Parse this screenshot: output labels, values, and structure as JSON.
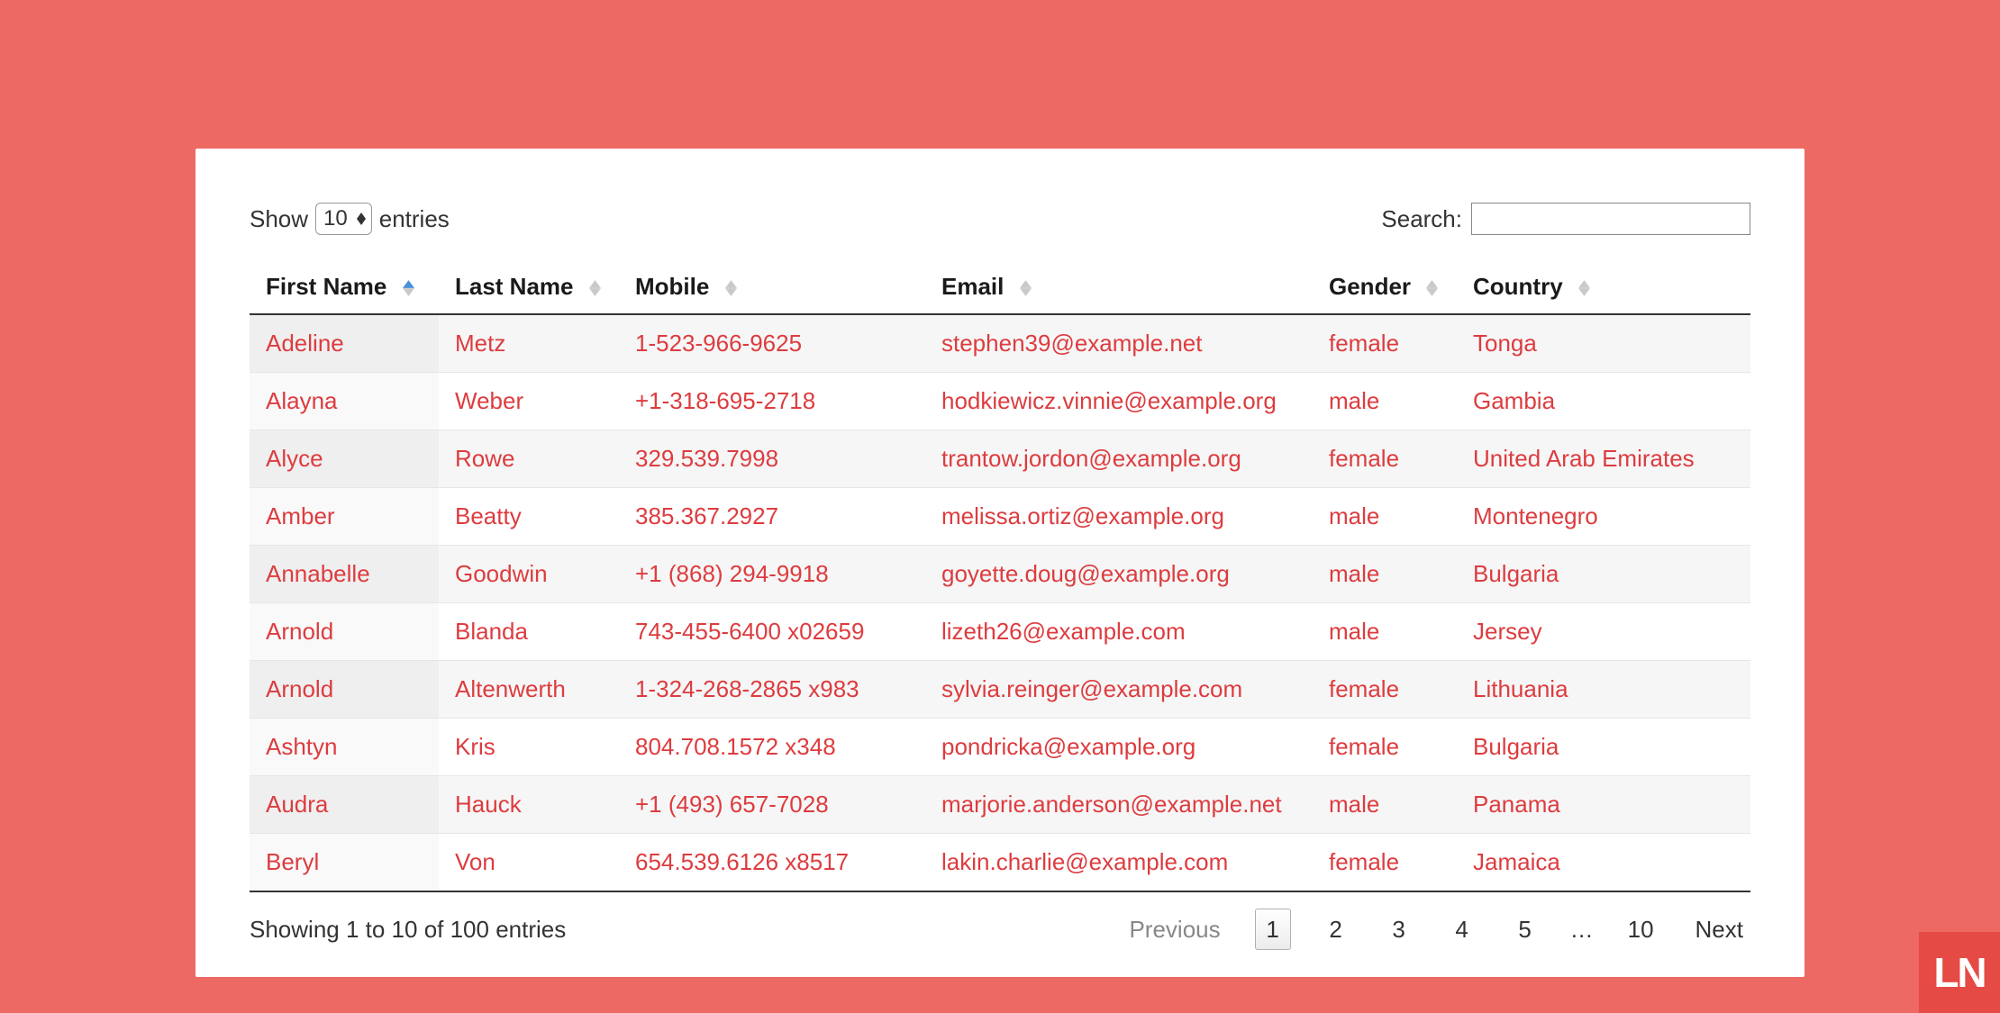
{
  "length_menu": {
    "prefix": "Show",
    "value": "10",
    "suffix": "entries"
  },
  "search": {
    "label": "Search:",
    "value": ""
  },
  "columns": [
    {
      "label": "First Name",
      "sorted": "asc"
    },
    {
      "label": "Last Name"
    },
    {
      "label": "Mobile"
    },
    {
      "label": "Email"
    },
    {
      "label": "Gender"
    },
    {
      "label": "Country"
    }
  ],
  "rows": [
    {
      "first": "Adeline",
      "last": "Metz",
      "mobile": "1-523-966-9625",
      "email": "stephen39@example.net",
      "gender": "female",
      "country": "Tonga"
    },
    {
      "first": "Alayna",
      "last": "Weber",
      "mobile": "+1-318-695-2718",
      "email": "hodkiewicz.vinnie@example.org",
      "gender": "male",
      "country": "Gambia"
    },
    {
      "first": "Alyce",
      "last": "Rowe",
      "mobile": "329.539.7998",
      "email": "trantow.jordon@example.org",
      "gender": "female",
      "country": "United Arab Emirates"
    },
    {
      "first": "Amber",
      "last": "Beatty",
      "mobile": "385.367.2927",
      "email": "melissa.ortiz@example.org",
      "gender": "male",
      "country": "Montenegro"
    },
    {
      "first": "Annabelle",
      "last": "Goodwin",
      "mobile": "+1 (868) 294-9918",
      "email": "goyette.doug@example.org",
      "gender": "male",
      "country": "Bulgaria"
    },
    {
      "first": "Arnold",
      "last": "Blanda",
      "mobile": "743-455-6400 x02659",
      "email": "lizeth26@example.com",
      "gender": "male",
      "country": "Jersey"
    },
    {
      "first": "Arnold",
      "last": "Altenwerth",
      "mobile": "1-324-268-2865 x983",
      "email": "sylvia.reinger@example.com",
      "gender": "female",
      "country": "Lithuania"
    },
    {
      "first": "Ashtyn",
      "last": "Kris",
      "mobile": "804.708.1572 x348",
      "email": "pondricka@example.org",
      "gender": "female",
      "country": "Bulgaria"
    },
    {
      "first": "Audra",
      "last": "Hauck",
      "mobile": "+1 (493) 657-7028",
      "email": "marjorie.anderson@example.net",
      "gender": "male",
      "country": "Panama"
    },
    {
      "first": "Beryl",
      "last": "Von",
      "mobile": "654.539.6126 x8517",
      "email": "lakin.charlie@example.com",
      "gender": "female",
      "country": "Jamaica"
    }
  ],
  "info": "Showing 1 to 10 of 100 entries",
  "pagination": {
    "previous": "Previous",
    "next": "Next",
    "pages": [
      "1",
      "2",
      "3",
      "4",
      "5",
      "…",
      "10"
    ],
    "current": "1"
  },
  "logo": "LN"
}
